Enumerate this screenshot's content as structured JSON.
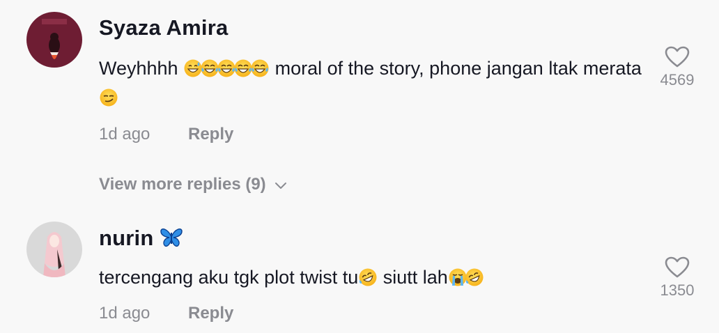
{
  "comments": [
    {
      "username": "Syaza Amira",
      "text_part1": "Weyhhhh ",
      "text_part2": " moral of the story, phone jangan ltak merata ",
      "emojis_part1": [
        "sweat-smile-emoji",
        "tears-of-joy-emoji",
        "tears-of-joy-emoji",
        "tears-of-joy-emoji",
        "tears-of-joy-emoji"
      ],
      "emojis_part2": [
        "smirk-emoji"
      ],
      "time": "1d ago",
      "reply_label": "Reply",
      "view_more_label": "View more replies (9)",
      "likes": "4569"
    },
    {
      "username": "nurin",
      "username_emoji": "butterfly-emoji",
      "text_part1": "tercengang aku tgk plot twist tu",
      "text_part2": " siutt lah",
      "emojis_part1": [
        "rofl-emoji"
      ],
      "emojis_part2": [
        "loudly-crying-emoji",
        "rofl-emoji"
      ],
      "time": "1d ago",
      "reply_label": "Reply",
      "likes": "1350"
    }
  ],
  "colors": {
    "background": "#f8f8f8",
    "text": "#161823",
    "muted": "#8a8b91",
    "butterfly": "#2f8ee6"
  }
}
